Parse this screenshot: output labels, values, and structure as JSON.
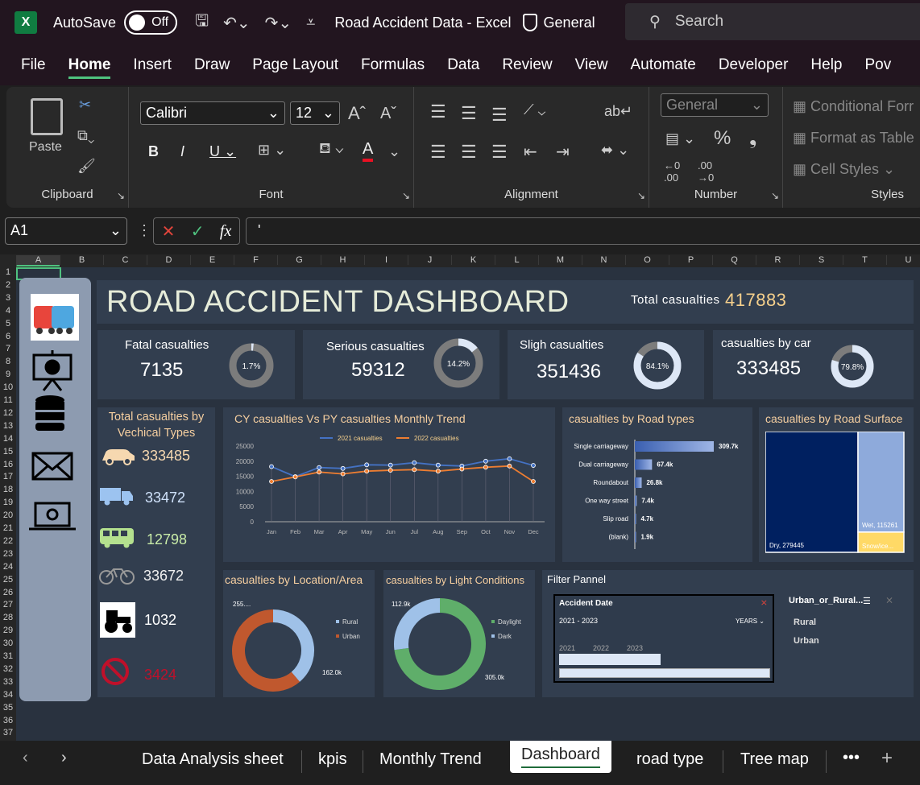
{
  "titlebar": {
    "app_icon": "X",
    "autosave_label": "AutoSave",
    "autosave_state": "Off",
    "doc_title": "Road Accident Data  -  Excel",
    "sensitivity": "General",
    "search_placeholder": "Search"
  },
  "menu": [
    "File",
    "Home",
    "Insert",
    "Draw",
    "Page Layout",
    "Formulas",
    "Data",
    "Review",
    "View",
    "Automate",
    "Developer",
    "Help",
    "Pov"
  ],
  "ribbon": {
    "clipboard_label": "Clipboard",
    "paste_label": "Paste",
    "font_label": "Font",
    "font_name": "Calibri",
    "font_size": "12",
    "alignment_label": "Alignment",
    "number_label": "Number",
    "number_format": "General",
    "styles_label": "Styles",
    "conditional_formatting": "Conditional Forr",
    "format_as_table": "Format as Table",
    "cell_styles": "Cell Styles"
  },
  "formula": {
    "name_box": "A1",
    "fx": "fx",
    "content": "'"
  },
  "columns": [
    "A",
    "B",
    "C",
    "D",
    "E",
    "F",
    "G",
    "H",
    "I",
    "J",
    "K",
    "L",
    "M",
    "N",
    "O",
    "P",
    "Q",
    "R",
    "S",
    "T",
    "U"
  ],
  "rows": [
    "1",
    "2",
    "3",
    "4",
    "5",
    "6",
    "7",
    "8",
    "9",
    "10",
    "11",
    "12",
    "13",
    "14",
    "15",
    "16",
    "17",
    "18",
    "19",
    "20",
    "21",
    "22",
    "23",
    "24",
    "25",
    "26",
    "27",
    "28",
    "29",
    "30",
    "31",
    "32",
    "33",
    "34",
    "35",
    "36",
    "37"
  ],
  "dashboard": {
    "title": "ROAD ACCIDENT DASHBOARD",
    "total_label": "Total casualties",
    "total_value": "417883",
    "kpis": [
      {
        "label": "Fatal casualties",
        "value": "7135",
        "pct": "1.7%",
        "share": 0.017
      },
      {
        "label": "Serious casualties",
        "value": "59312",
        "pct": "14.2%",
        "share": 0.142
      },
      {
        "label": "Sligh  casualties",
        "value": "351436",
        "pct": "84.1%",
        "share": 0.841
      },
      {
        "label": "casualties by car",
        "value": "333485",
        "pct": "79.8%",
        "share": 0.798
      }
    ],
    "vehicle_title": "Total casualties by Vechical Types",
    "vehicles": [
      {
        "icon": "car-icon",
        "value": "333485"
      },
      {
        "icon": "truck-icon",
        "value": "33472"
      },
      {
        "icon": "bus-icon",
        "value": "12798"
      },
      {
        "icon": "bicycle-icon",
        "value": "33672"
      },
      {
        "icon": "tractor-icon",
        "value": "1032"
      },
      {
        "icon": "no-entry-icon",
        "value": "3424"
      }
    ],
    "sidebar_icons": [
      "cars-icon",
      "presentation-icon",
      "database-icon",
      "mail-icon",
      "laptop-icon"
    ],
    "filter": {
      "title": "Filter Pannel",
      "slicer_title": "Accident Date",
      "range": "2021 - 2023",
      "unit": "YEARS",
      "years": [
        "2021",
        "2022",
        "2023"
      ],
      "urban_title": "Urban_or_Rural...",
      "urban_items": [
        "Rural",
        "Urban"
      ]
    }
  },
  "chart_data": [
    {
      "type": "line",
      "title": "CY casualties Vs PY casualties Monthly Trend",
      "categories": [
        "Jan",
        "Feb",
        "Mar",
        "Apr",
        "May",
        "Jun",
        "Jul",
        "Aug",
        "Sep",
        "Oct",
        "Nov",
        "Dec"
      ],
      "ylim": [
        0,
        25000
      ],
      "yticks": [
        "0",
        "5000",
        "10000",
        "15000",
        "20000",
        "25000"
      ],
      "series": [
        {
          "name": "2021 casualties",
          "color": "#4472c4",
          "values": [
            18200,
            14900,
            17900,
            17600,
            18800,
            18700,
            19500,
            18700,
            18400,
            20000,
            20800,
            18600
          ]
        },
        {
          "name": "2022 casualties",
          "color": "#ed7d31",
          "values": [
            13300,
            14800,
            16400,
            15800,
            16700,
            17000,
            17200,
            16700,
            17400,
            18000,
            18400,
            13300
          ]
        }
      ]
    },
    {
      "type": "bar",
      "title": "casualties by Road types",
      "categories": [
        "Single carriageway",
        "Dual carriageway",
        "Roundabout",
        "One way street",
        "Slip road",
        "(blank)"
      ],
      "values": [
        309.7,
        67.4,
        26.8,
        7.4,
        4.7,
        1.9
      ],
      "labels": [
        "309.7k",
        "67.4k",
        "26.8k",
        "7.4k",
        "4.7k",
        "1.9k"
      ]
    },
    {
      "type": "treemap",
      "title": "casualties by Road Surface",
      "categories": [
        "Dry",
        "Wet",
        "Snow/ice..."
      ],
      "values": [
        279445,
        115261,
        23177
      ],
      "labels": [
        "Dry, 279445",
        "Wet, 115261",
        "Snow/ice..."
      ]
    },
    {
      "type": "pie",
      "title": "casualties by Location/Area",
      "categories": [
        "Rural",
        "Urban"
      ],
      "values": [
        162.0,
        255.8
      ],
      "labels": [
        "162.0k",
        "255...."
      ]
    },
    {
      "type": "pie",
      "title": "casualties by Light Conditions",
      "categories": [
        "Daylight",
        "Dark"
      ],
      "values": [
        305.0,
        112.9
      ],
      "labels": [
        "305.0k",
        "112.9k"
      ]
    }
  ],
  "tabs": [
    "Data Analysis sheet",
    "kpis",
    "Monthly Trend",
    "Dashboard",
    "road type",
    "Tree map"
  ],
  "active_tab": "Dashboard"
}
